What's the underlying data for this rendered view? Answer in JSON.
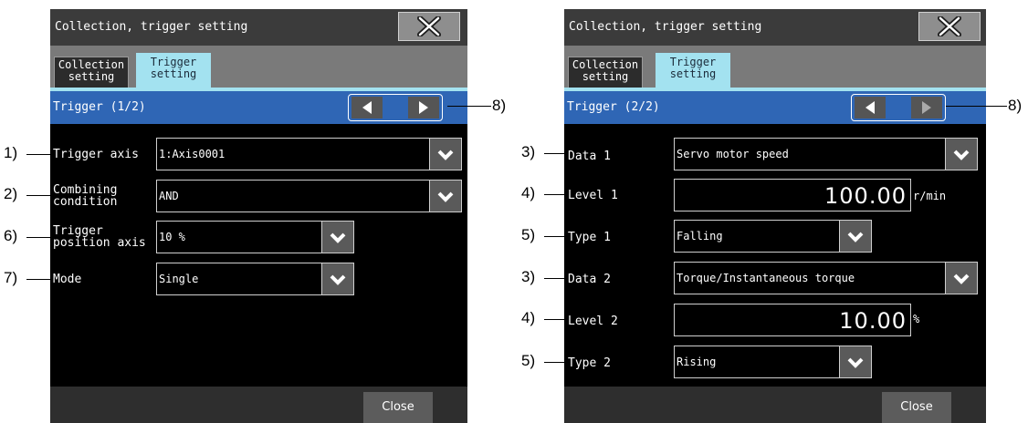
{
  "left": {
    "title": "Collection, trigger setting",
    "tabs": [
      {
        "label_line1": "Collection",
        "label_line2": "setting"
      },
      {
        "label_line1": "Trigger",
        "label_line2": "setting"
      }
    ],
    "section_title": "Trigger (1/2)",
    "rows": [
      {
        "label": "Trigger axis",
        "value": "1:Axis0001"
      },
      {
        "label_line1": "Combining",
        "label_line2": "condition",
        "value": "AND"
      },
      {
        "label_line1": "Trigger",
        "label_line2": "position axis",
        "value": "10 %"
      },
      {
        "label": "Mode",
        "value": "Single"
      }
    ],
    "close_label": "Close",
    "callouts": [
      "1)",
      "2)",
      "6)",
      "7)",
      "8)"
    ]
  },
  "right": {
    "title": "Collection, trigger setting",
    "tabs": [
      {
        "label_line1": "Collection",
        "label_line2": "setting"
      },
      {
        "label_line1": "Trigger",
        "label_line2": "setting"
      }
    ],
    "section_title": "Trigger (2/2)",
    "rows": [
      {
        "label": "Data 1",
        "value": "Servo motor speed"
      },
      {
        "label": "Level 1",
        "value": "100.00",
        "unit": "r/min"
      },
      {
        "label": "Type 1",
        "value": "Falling"
      },
      {
        "label": "Data 2",
        "value": "Torque/Instantaneous torque"
      },
      {
        "label": "Level 2",
        "value": "10.00",
        "unit": "%"
      },
      {
        "label": "Type 2",
        "value": "Rising"
      }
    ],
    "close_label": "Close",
    "callouts": [
      "3)",
      "4)",
      "5)",
      "3)",
      "4)",
      "5)",
      "8)"
    ]
  },
  "icons": {
    "close": "close-x-icon",
    "dropdown": "chevron-down-icon",
    "prev": "triangle-left-icon",
    "next": "triangle-right-icon"
  }
}
